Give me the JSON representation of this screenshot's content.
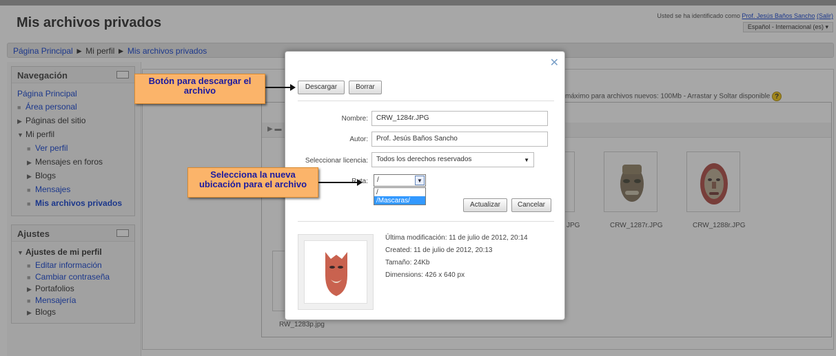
{
  "header": {
    "title": "Mis archivos privados",
    "login_prefix": "Usted se ha identificado como ",
    "user_name": "Prof. Jesús Baños Sancho",
    "logout": "(Salir)",
    "language": "Español - Internacional (es)"
  },
  "breadcrumb": {
    "home": "Página Principal",
    "separator": "►",
    "profile": "Mi perfil",
    "current": "Mis archivos privados"
  },
  "navigation": {
    "title": "Navegación",
    "items": [
      {
        "label": "Página Principal"
      },
      {
        "label": "Área personal"
      },
      {
        "label": "Páginas del sitio"
      },
      {
        "label": "Mi perfil"
      },
      {
        "label": "Ver perfil"
      },
      {
        "label": "Mensajes en foros"
      },
      {
        "label": "Blogs"
      },
      {
        "label": "Mensajes"
      },
      {
        "label": "Mis archivos privados"
      }
    ]
  },
  "settings": {
    "title": "Ajustes",
    "items": [
      {
        "label": "Ajustes de mi perfil"
      },
      {
        "label": "Editar información"
      },
      {
        "label": "Cambiar contraseña"
      },
      {
        "label": "Portafolios"
      },
      {
        "label": "Mensajería"
      },
      {
        "label": "Blogs"
      }
    ]
  },
  "files": {
    "info": "máximo para archivos nuevos: 100Mb - Arrastar y Soltar disponible",
    "thumbs": [
      {
        "label": "JPG"
      },
      {
        "label": "CRW_1287r.JPG"
      },
      {
        "label": "CRW_1288r.JPG"
      },
      {
        "label": "RW_1283p.jpg"
      }
    ]
  },
  "dialog": {
    "download": "Descargar",
    "delete": "Borrar",
    "name_label": "Nombre:",
    "name_value": "CRW_1284r.JPG",
    "author_label": "Autor:",
    "author_value": "Prof. Jesús Baños Sancho",
    "license_label": "Seleccionar licencia:",
    "license_value": "Todos los derechos reservados",
    "path_label": "Ruta:",
    "path_value": "/",
    "path_options": [
      "/",
      "/Mascaras/"
    ],
    "update": "Actualizar",
    "cancel": "Cancelar",
    "modified": "Última modificación: 11 de julio de 2012, 20:14",
    "created": "Created: 11 de julio de 2012, 20:13",
    "size": "Tamaño: 24Kb",
    "dimensions": "Dimensions: 426 x 640 px"
  },
  "callouts": {
    "download_line1": "Botón para descargar el",
    "download_line2": "archivo",
    "path_line1": "Selecciona la nueva",
    "path_line2": "ubicación para el archivo"
  }
}
